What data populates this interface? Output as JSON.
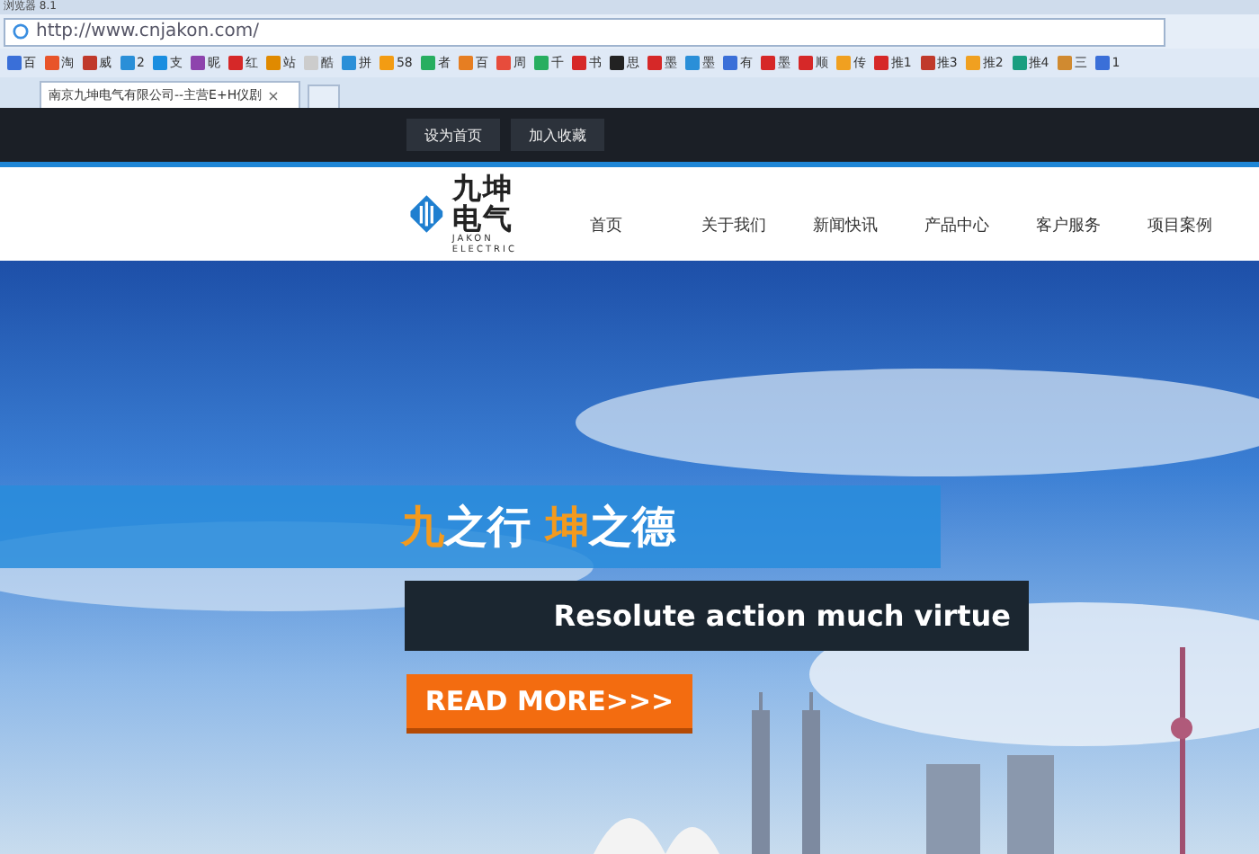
{
  "window": {
    "title": "浏览器 8.1"
  },
  "address_bar": {
    "url": "http://www.cnjakon.com/"
  },
  "bookmarks": [
    {
      "label": "百",
      "color": "#3a6fd8"
    },
    {
      "label": "淘",
      "color": "#e8542a"
    },
    {
      "label": "威",
      "color": "#c0392b"
    },
    {
      "label": "2",
      "color": "#2a8fd8"
    },
    {
      "label": "支",
      "color": "#1a8ee0"
    },
    {
      "label": "昵",
      "color": "#8e44ad"
    },
    {
      "label": "红",
      "color": "#d62828"
    },
    {
      "label": "站",
      "color": "#e08a00"
    },
    {
      "label": "酷",
      "color": "#cccccc"
    },
    {
      "label": "拼",
      "color": "#2a8fd8"
    },
    {
      "label": "58",
      "color": "#f39c12"
    },
    {
      "label": "者",
      "color": "#27ae60"
    },
    {
      "label": "百",
      "color": "#e67e22"
    },
    {
      "label": "周",
      "color": "#e74c3c"
    },
    {
      "label": "千",
      "color": "#27ae60"
    },
    {
      "label": "书",
      "color": "#d62828"
    },
    {
      "label": "思",
      "color": "#222222"
    },
    {
      "label": "墨",
      "color": "#d62828"
    },
    {
      "label": "墨",
      "color": "#2a8fd8"
    },
    {
      "label": "有",
      "color": "#3a6fd8"
    },
    {
      "label": "墨",
      "color": "#d62828"
    },
    {
      "label": "顺",
      "color": "#d62828"
    },
    {
      "label": "传",
      "color": "#f0a020"
    },
    {
      "label": "推1",
      "color": "#d62828"
    },
    {
      "label": "推3",
      "color": "#c0392b"
    },
    {
      "label": "推2",
      "color": "#f0a020"
    },
    {
      "label": "推4",
      "color": "#1a9e80"
    },
    {
      "label": "三",
      "color": "#d08a30"
    },
    {
      "label": "1",
      "color": "#3a6fd8"
    }
  ],
  "tabs": [
    {
      "label": "南京九坤电气有限公司--主营E+H仪剧",
      "close": "×",
      "selected": true
    }
  ],
  "top_bar": {
    "buttons": [
      "设为首页",
      "加入收藏"
    ]
  },
  "header": {
    "logo_name": "九坤电气",
    "logo_subtitle": "JAKON ELECTRIC",
    "nav": [
      {
        "label": "首页",
        "selected": false
      },
      {
        "label": "关于我们",
        "selected": false
      },
      {
        "label": "新闻快讯",
        "selected": false
      },
      {
        "label": "产品中心",
        "selected": false
      },
      {
        "label": "客户服务",
        "selected": false
      },
      {
        "label": "项目案例",
        "selected": false
      }
    ]
  },
  "hero": {
    "tagline": "**九**之行 **坤**之德",
    "subtitle": "Resolute action much virtue",
    "button": "READ MORE>>>"
  }
}
